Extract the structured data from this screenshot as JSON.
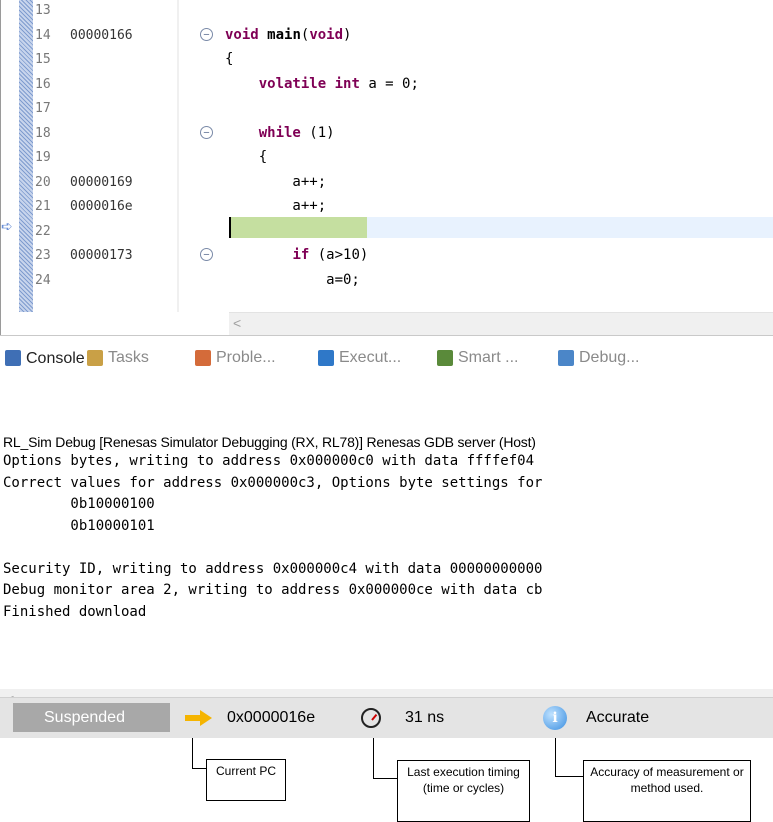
{
  "editor": {
    "lines": [
      {
        "num": "13",
        "addr": "",
        "code": ""
      },
      {
        "num": "14",
        "addr": "00000166",
        "code": "void main(void)"
      },
      {
        "num": "15",
        "addr": "",
        "code": "{"
      },
      {
        "num": "16",
        "addr": "",
        "code": "    volatile int a = 0;"
      },
      {
        "num": "17",
        "addr": "",
        "code": ""
      },
      {
        "num": "18",
        "addr": "",
        "code": "    while (1)"
      },
      {
        "num": "19",
        "addr": "",
        "code": "    {"
      },
      {
        "num": "20",
        "addr": "00000169",
        "code": "        a++;"
      },
      {
        "num": "21",
        "addr": "0000016e",
        "code": "        a++;"
      },
      {
        "num": "22",
        "addr": "",
        "code": ""
      },
      {
        "num": "23",
        "addr": "00000173",
        "code": "        if (a>10)"
      },
      {
        "num": "24",
        "addr": "",
        "code": "            a=0;"
      }
    ],
    "scroll_left_label": "<"
  },
  "tabs": [
    {
      "label": "Console ☒",
      "icon": "console-icon",
      "color": "#3f6fb5",
      "active": true
    },
    {
      "label": "Tasks",
      "icon": "tasks-icon",
      "color": "#c9a046",
      "active": false
    },
    {
      "label": "Proble...",
      "icon": "problems-icon",
      "color": "#d46b3a",
      "active": false
    },
    {
      "label": "Execut...",
      "icon": "execute-icon",
      "color": "#2f78c8",
      "active": false
    },
    {
      "label": "Smart ...",
      "icon": "smart-icon",
      "color": "#5a8a3a",
      "active": false
    },
    {
      "label": "Debug...",
      "icon": "debug-icon",
      "color": "#4b86c8",
      "active": false
    }
  ],
  "console": {
    "title": "RL_Sim Debug [Renesas Simulator Debugging (RX, RL78)] Renesas GDB server (Host)",
    "lines": [
      "Options bytes, writing to address 0x000000c0 with data ffffef04",
      "Correct values for address 0x000000c3, Options byte settings for",
      "        0b10000100",
      "        0b10000101",
      "",
      "Security ID, writing to address 0x000000c4 with data 00000000000",
      "Debug monitor area 2, writing to address 0x000000ce with data cb",
      "Finished download"
    ],
    "scroll_left_label": "<"
  },
  "status": {
    "state": "Suspended",
    "pc": "0x0000016e",
    "timing": "31 ns",
    "accuracy": "Accurate",
    "info_glyph": "i"
  },
  "callouts": {
    "pc": "Current PC",
    "timing": "Last execution timing (time or cycles)",
    "accuracy": "Accuracy of measurement or method used."
  }
}
